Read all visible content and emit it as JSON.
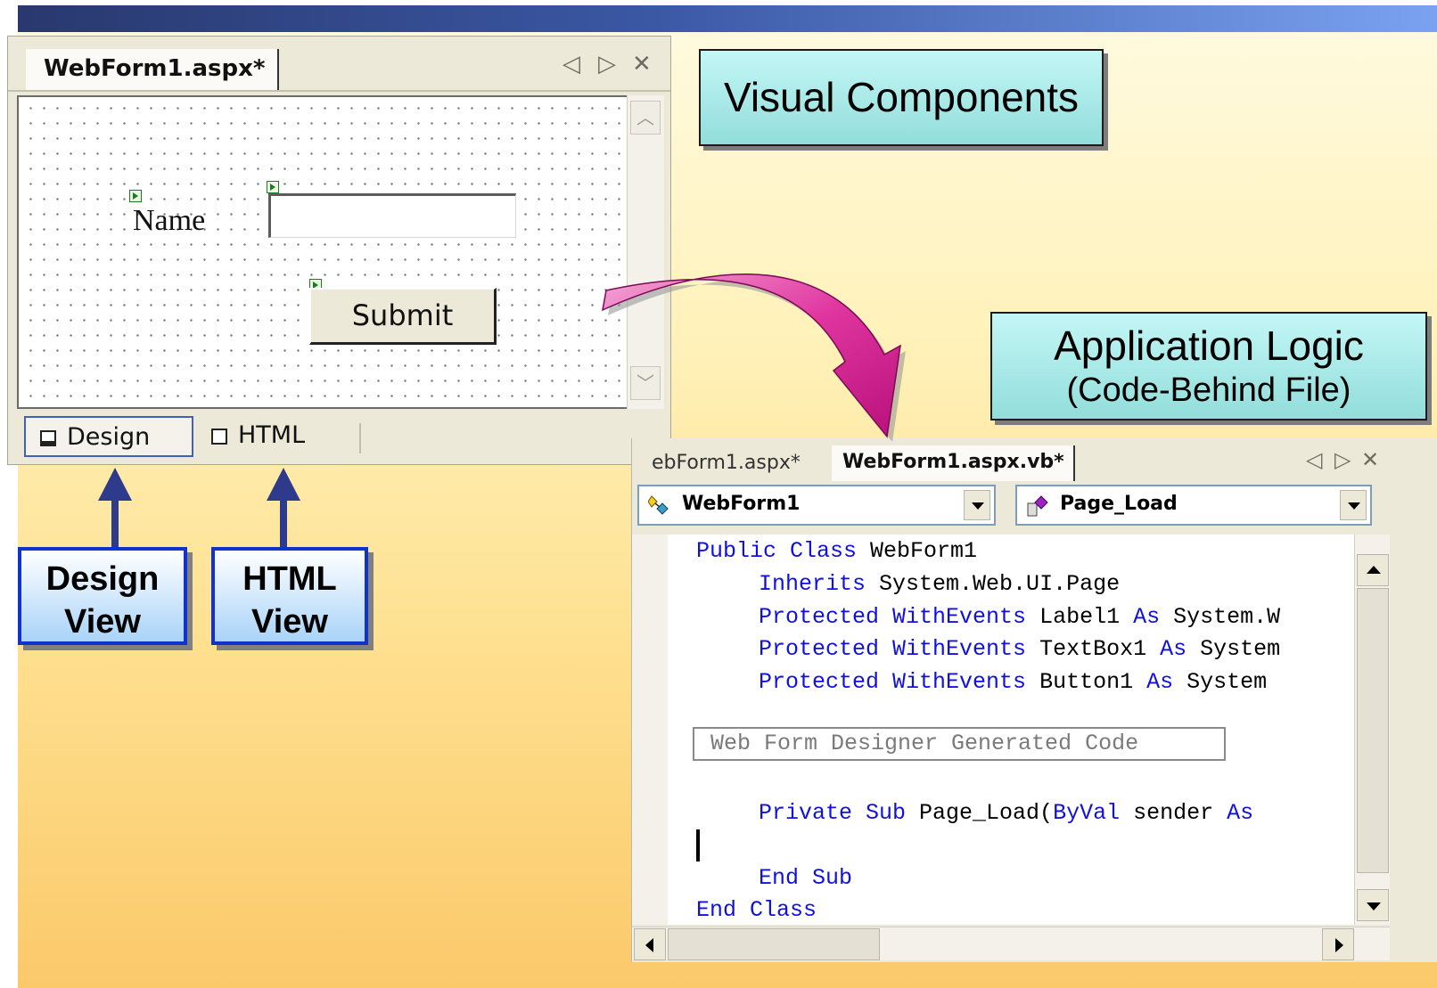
{
  "slide": {
    "callouts": {
      "visual_components": "Visual Components",
      "application_logic": "Application Logic",
      "code_behind": "(Code-Behind File)"
    },
    "labels": {
      "design_view": [
        "Design",
        "View"
      ],
      "html_view": [
        "HTML",
        "View"
      ]
    },
    "colors": {
      "callout_fill": "#a6e9e7",
      "label_border": "#1133cc",
      "arrow_fill": "#e0359f",
      "keyword": "#1010e0"
    }
  },
  "designer": {
    "tab_title": "WebForm1.aspx*",
    "window_controls": [
      "prev-tab-icon",
      "next-tab-icon",
      "close-icon"
    ],
    "form": {
      "name_label": "Name",
      "textbox_value": "",
      "submit_label": "Submit"
    },
    "view_tabs": {
      "design": "Design",
      "html": "HTML",
      "active": "Design"
    }
  },
  "code_editor": {
    "tabs": [
      "ebForm1.aspx*",
      "WebForm1.aspx.vb*"
    ],
    "active_tab": "WebForm1.aspx.vb*",
    "class_combo": "WebForm1",
    "method_combo": "Page_Load",
    "lines": {
      "l1": {
        "kw": "Public Class",
        "rest": " WebForm1"
      },
      "l2": {
        "kw": "Inherits",
        "rest": " System.Web.UI.Page"
      },
      "l3": {
        "kw": "Protected WithEvents",
        "rest": " Label1 ",
        "kw2": "As",
        "rest2": " System.W"
      },
      "l4": {
        "kw": "Protected WithEvents",
        "rest": " TextBox1 ",
        "kw2": "As",
        "rest2": " System"
      },
      "l5": {
        "kw": "Protected WithEvents",
        "rest": " Button1 ",
        "kw2": "As",
        "rest2": " System"
      },
      "region": "Web Form Designer Generated Code",
      "l6": {
        "kw": "Private Sub",
        "rest": " Page_Load(",
        "kw2": "ByVal",
        "rest2": " sender ",
        "kw3": "As"
      },
      "l7": {
        "kw": "End Sub"
      },
      "l8": {
        "kw": "End Class"
      }
    }
  }
}
